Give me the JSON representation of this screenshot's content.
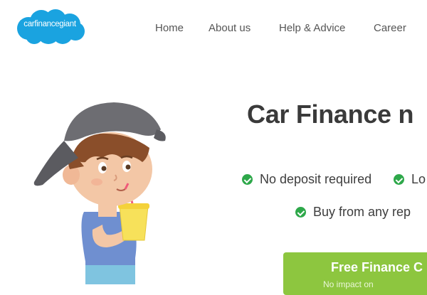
{
  "brand": {
    "logo_text": "carfinancegiant",
    "logo_color": "#1aa3e0"
  },
  "nav": {
    "items": [
      "Home",
      "About us",
      "Help & Advice",
      "Career"
    ]
  },
  "hero": {
    "title": "Car Finance n",
    "features": [
      "No deposit required",
      "Lo",
      "Buy from any rep"
    ],
    "cta_label": "Free Finance C",
    "cta_sub": "No impact on",
    "cta_color": "#8dc63f",
    "check_color": "#2ea84a"
  }
}
